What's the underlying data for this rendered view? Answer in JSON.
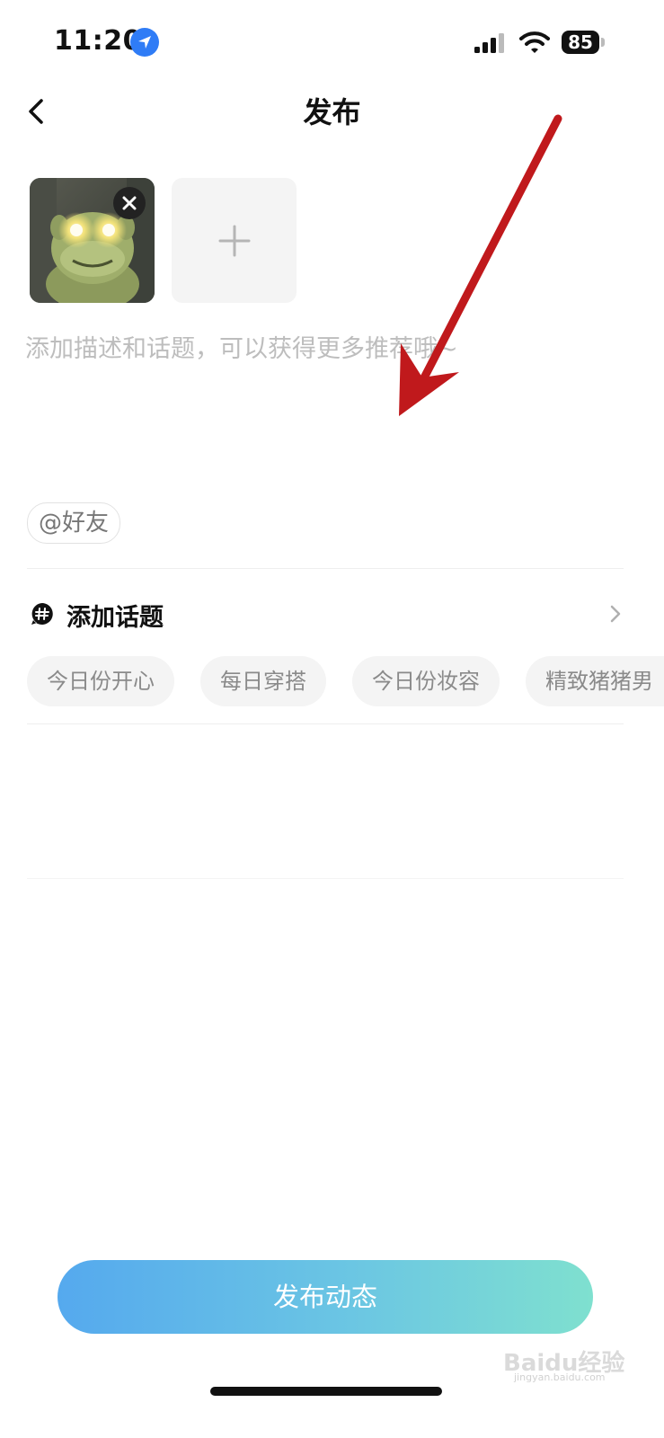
{
  "status_bar": {
    "time": "11:20",
    "battery": "85",
    "icons": [
      "location-icon",
      "signal-icon",
      "wifi-icon",
      "battery-icon"
    ]
  },
  "header": {
    "title": "发布",
    "back_icon": "chevron-left-icon"
  },
  "media": {
    "image_count": 1,
    "add_icon": "plus-icon",
    "remove_icon": "close-icon"
  },
  "description": {
    "placeholder": "添加描述和话题，可以获得更多推荐哦~",
    "value": ""
  },
  "mention": {
    "label": "@好友"
  },
  "topics": {
    "label": "添加话题",
    "icon": "hash-icon",
    "chips": [
      "今日份开心",
      "每日穿搭",
      "今日份妆容",
      "精致猪猪男"
    ]
  },
  "publish": {
    "label": "发布动态"
  },
  "watermark": {
    "text": "Baidu经验",
    "sub": "jingyan.baidu.com"
  },
  "colors": {
    "gradient_start": "#55a9ee",
    "gradient_end": "#7fe0cf",
    "annotation_arrow": "#c0191c",
    "location_blue": "#2f7cf6"
  }
}
